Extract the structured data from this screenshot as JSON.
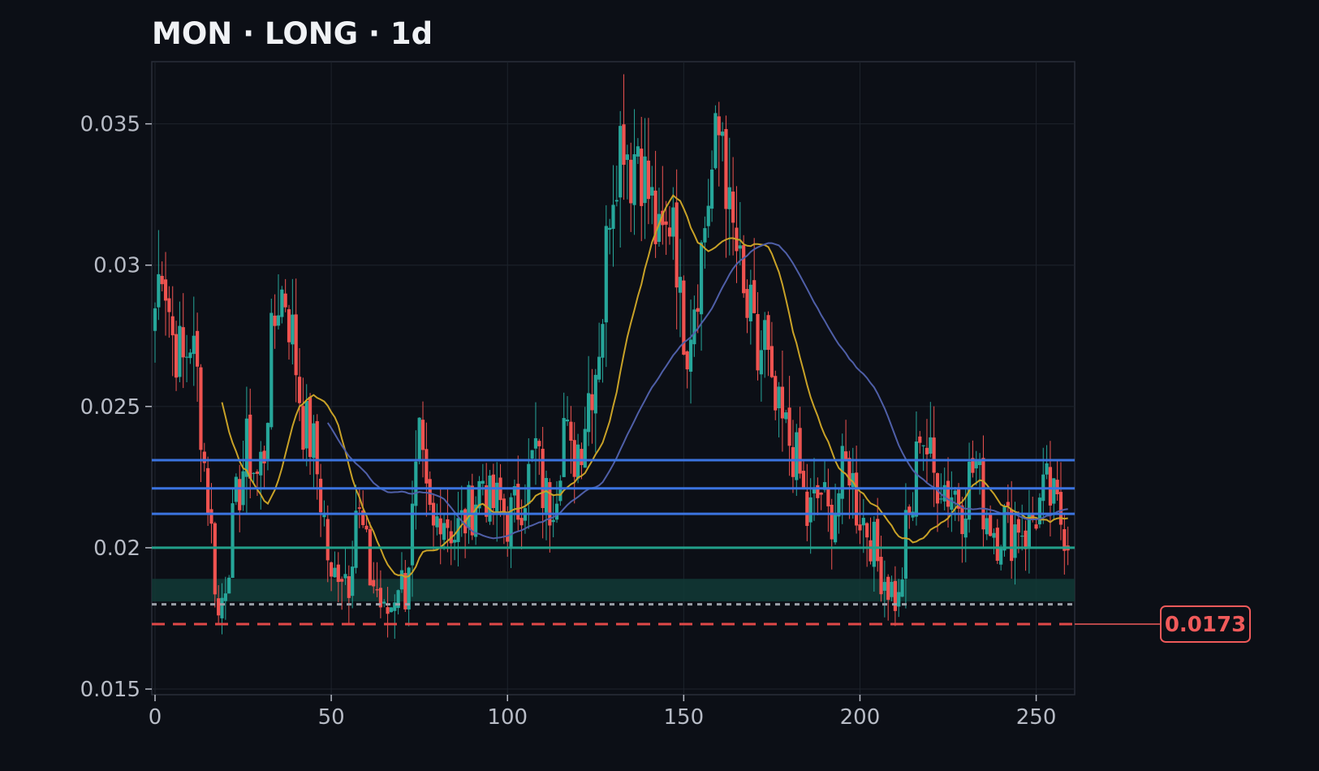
{
  "chart_data": {
    "type": "candlestick",
    "title": "MON · LONG · 1d",
    "xlim": [
      0,
      260
    ],
    "ylim": [
      0.0148,
      0.0372
    ],
    "x_ticks": [
      0,
      50,
      100,
      150,
      200,
      250
    ],
    "y_ticks": [
      0.015,
      0.02,
      0.025,
      0.03,
      0.035
    ],
    "y_tick_labels": [
      "0.015",
      "0.02",
      "0.025",
      "0.03",
      "0.035"
    ],
    "grid": true,
    "close_anchors": [
      [
        0,
        0.0285
      ],
      [
        2,
        0.0305
      ],
      [
        5,
        0.0275
      ],
      [
        8,
        0.0265
      ],
      [
        10,
        0.0275
      ],
      [
        12,
        0.026
      ],
      [
        14,
        0.023
      ],
      [
        16,
        0.0205
      ],
      [
        18,
        0.0175
      ],
      [
        20,
        0.019
      ],
      [
        23,
        0.0215
      ],
      [
        26,
        0.0235
      ],
      [
        29,
        0.0225
      ],
      [
        31,
        0.0235
      ],
      [
        33,
        0.027
      ],
      [
        35,
        0.029
      ],
      [
        37,
        0.029
      ],
      [
        39,
        0.0275
      ],
      [
        42,
        0.0245
      ],
      [
        45,
        0.0235
      ],
      [
        48,
        0.021
      ],
      [
        50,
        0.0185
      ],
      [
        52,
        0.0195
      ],
      [
        55,
        0.019
      ],
      [
        57,
        0.0215
      ],
      [
        59,
        0.0205
      ],
      [
        61,
        0.019
      ],
      [
        63,
        0.0185
      ],
      [
        65,
        0.0175
      ],
      [
        67,
        0.018
      ],
      [
        69,
        0.019
      ],
      [
        71,
        0.0185
      ],
      [
        73,
        0.021
      ],
      [
        75,
        0.0235
      ],
      [
        77,
        0.0215
      ],
      [
        79,
        0.0205
      ],
      [
        81,
        0.0215
      ],
      [
        83,
        0.021
      ],
      [
        85,
        0.0205
      ],
      [
        88,
        0.021
      ],
      [
        90,
        0.0215
      ],
      [
        93,
        0.0225
      ],
      [
        95,
        0.0215
      ],
      [
        98,
        0.0215
      ],
      [
        100,
        0.021
      ],
      [
        103,
        0.0215
      ],
      [
        106,
        0.0225
      ],
      [
        108,
        0.0235
      ],
      [
        110,
        0.022
      ],
      [
        112,
        0.0215
      ],
      [
        114,
        0.0225
      ],
      [
        116,
        0.0245
      ],
      [
        118,
        0.023
      ],
      [
        121,
        0.024
      ],
      [
        123,
        0.0255
      ],
      [
        125,
        0.0265
      ],
      [
        127,
        0.0285
      ],
      [
        129,
        0.0325
      ],
      [
        131,
        0.034
      ],
      [
        133,
        0.035
      ],
      [
        135,
        0.0335
      ],
      [
        137,
        0.0345
      ],
      [
        139,
        0.033
      ],
      [
        141,
        0.032
      ],
      [
        143,
        0.0305
      ],
      [
        145,
        0.031
      ],
      [
        147,
        0.0325
      ],
      [
        149,
        0.0285
      ],
      [
        151,
        0.0275
      ],
      [
        153,
        0.029
      ],
      [
        155,
        0.0305
      ],
      [
        157,
        0.0325
      ],
      [
        159,
        0.034
      ],
      [
        161,
        0.035
      ],
      [
        163,
        0.0315
      ],
      [
        165,
        0.0305
      ],
      [
        167,
        0.0285
      ],
      [
        169,
        0.028
      ],
      [
        171,
        0.0265
      ],
      [
        173,
        0.0275
      ],
      [
        175,
        0.025
      ],
      [
        177,
        0.0245
      ],
      [
        179,
        0.024
      ],
      [
        181,
        0.0235
      ],
      [
        183,
        0.0225
      ],
      [
        185,
        0.021
      ],
      [
        187,
        0.0215
      ],
      [
        189,
        0.022
      ],
      [
        191,
        0.021
      ],
      [
        193,
        0.0215
      ],
      [
        195,
        0.0225
      ],
      [
        197,
        0.023
      ],
      [
        199,
        0.0215
      ],
      [
        201,
        0.021
      ],
      [
        203,
        0.0205
      ],
      [
        205,
        0.0195
      ],
      [
        207,
        0.019
      ],
      [
        209,
        0.0185
      ],
      [
        211,
        0.018
      ],
      [
        213,
        0.0205
      ],
      [
        215,
        0.0215
      ],
      [
        217,
        0.0245
      ],
      [
        219,
        0.0235
      ],
      [
        221,
        0.0225
      ],
      [
        223,
        0.0225
      ],
      [
        225,
        0.022
      ],
      [
        227,
        0.022
      ],
      [
        229,
        0.0215
      ],
      [
        231,
        0.0225
      ],
      [
        233,
        0.023
      ],
      [
        235,
        0.0215
      ],
      [
        237,
        0.021
      ],
      [
        239,
        0.0205
      ],
      [
        241,
        0.021
      ],
      [
        243,
        0.0205
      ],
      [
        245,
        0.021
      ],
      [
        247,
        0.0205
      ],
      [
        249,
        0.021
      ],
      [
        251,
        0.0215
      ],
      [
        253,
        0.022
      ],
      [
        255,
        0.0215
      ],
      [
        257,
        0.021
      ],
      [
        259,
        0.0205
      ]
    ],
    "moving_averages": [
      {
        "period": 20,
        "color": "#c9a227"
      },
      {
        "period": 50,
        "color": "#4f5fa8"
      }
    ],
    "horizontal_levels": [
      {
        "value": 0.0231,
        "color": "#3b74e0",
        "style": "solid"
      },
      {
        "value": 0.0221,
        "color": "#3b74e0",
        "style": "solid"
      },
      {
        "value": 0.0212,
        "color": "#3b74e0",
        "style": "solid"
      },
      {
        "value": 0.02,
        "color": "#22a08a",
        "style": "solid"
      },
      {
        "value": 0.018,
        "color": "#9aa0a8",
        "style": "dotted"
      },
      {
        "value": 0.0173,
        "color": "#e04848",
        "style": "dashed"
      }
    ],
    "zone": {
      "from": 0.0181,
      "to": 0.0189,
      "color": "#123a36"
    },
    "price_tag": {
      "value": 0.0173,
      "label": "0.0173",
      "color": "#f05a5a"
    },
    "colors": {
      "up": "#26a69a",
      "down": "#ef5350",
      "background": "#0c0f16",
      "grid": "#1e232c",
      "frame": "#2a2f38"
    }
  }
}
